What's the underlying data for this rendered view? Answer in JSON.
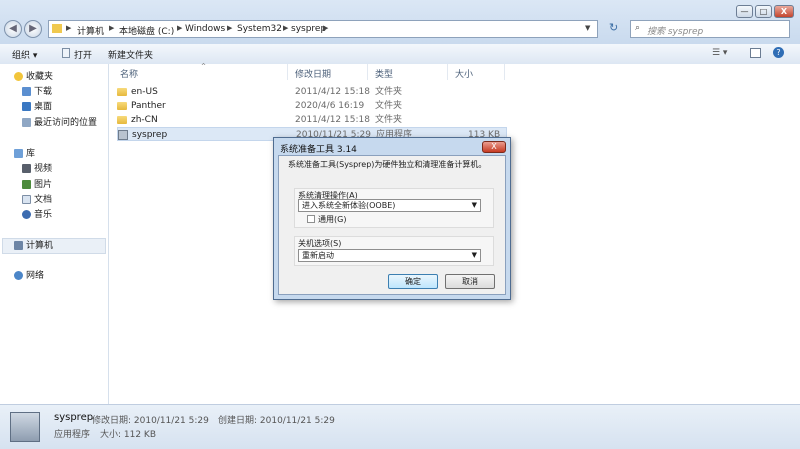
{
  "address_bar": {
    "crumbs": [
      "计算机",
      "本地磁盘 (C:)",
      "Windows",
      "System32",
      "sysprep"
    ]
  },
  "search": {
    "placeholder": "搜索 sysprep"
  },
  "window_controls": {
    "minimize": "—",
    "maximize": "□",
    "close": "X"
  },
  "toolbar": {
    "organize": "组织",
    "open": "打开",
    "new_folder": "新建文件夹"
  },
  "nav": {
    "favorites": "收藏夹",
    "favorites_items": [
      "下载",
      "桌面",
      "最近访问的位置"
    ],
    "libraries": "库",
    "library_items": [
      "视频",
      "图片",
      "文档",
      "音乐"
    ],
    "computer": "计算机",
    "network": "网络"
  },
  "columns": {
    "name": "名称",
    "modified": "修改日期",
    "type": "类型",
    "size": "大小"
  },
  "files": [
    {
      "name": "en-US",
      "modified": "2011/4/12 15:18",
      "type": "文件夹",
      "size": ""
    },
    {
      "name": "Panther",
      "modified": "2020/4/6 16:19",
      "type": "文件夹",
      "size": ""
    },
    {
      "name": "zh-CN",
      "modified": "2011/4/12 15:18",
      "type": "文件夹",
      "size": ""
    },
    {
      "name": "sysprep",
      "modified": "2010/11/21 5:29",
      "type": "应用程序",
      "size": "113 KB"
    }
  ],
  "status": {
    "name": "sysprep",
    "modified_label": "修改日期: 2010/11/21 5:29",
    "created_label": "创建日期: 2010/11/21 5:29",
    "type": "应用程序",
    "size_label": "大小: 112 KB"
  },
  "dialog": {
    "title": "系统准备工具 3.14",
    "close": "X",
    "description": "系统准备工具(Sysprep)为硬件独立和清理准备计算机。",
    "cleanup_label": "系统清理操作(A)",
    "cleanup_value": "进入系统全新体验(OOBE)",
    "generalize_label": "通用(G)",
    "shutdown_label": "关机选项(S)",
    "shutdown_value": "重新启动",
    "ok": "确定",
    "cancel": "取消"
  },
  "colors": {
    "dialog_bg": "#c6d9ee",
    "selection": "#dce8f6",
    "accent": "#3c7fb1"
  }
}
